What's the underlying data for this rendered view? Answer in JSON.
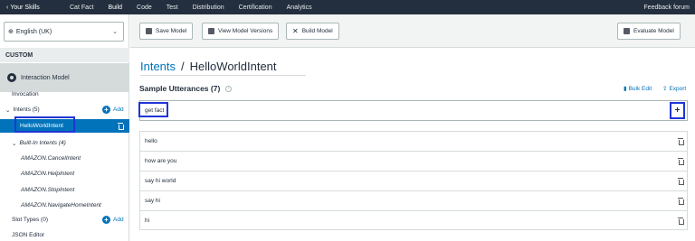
{
  "topnav": {
    "back_label": "Your Skills",
    "tabs": [
      "Cat Fact",
      "Build",
      "Code",
      "Test",
      "Distribution",
      "Certification",
      "Analytics"
    ],
    "active_tab": "Build",
    "feedback": "Feedback forum"
  },
  "sidebar": {
    "language": "English (UK)",
    "section": "CUSTOM",
    "interaction_model": "Interaction Model",
    "invocation": "Invocation",
    "intents": "Intents (5)",
    "add_label": "Add",
    "selected_intent": "HelloWorldIntent",
    "builtin": "Built-In Intents (4)",
    "builtin_items": [
      "AMAZON.CancelIntent",
      "AMAZON.HelpIntent",
      "AMAZON.StopIntent",
      "AMAZON.NavigateHomeIntent"
    ],
    "slot_types": "Slot Types (0)",
    "json_editor": "JSON Editor"
  },
  "toolbar": {
    "save": "Save Model",
    "versions": "View Model Versions",
    "build": "Build Model",
    "evaluate": "Evaluate Model"
  },
  "main": {
    "breadcrumb_link": "Intents",
    "breadcrumb_sep": "/",
    "breadcrumb_current": "HelloWorldIntent",
    "title": "Sample Utterances (7)",
    "bulk_edit": "Bulk Edit",
    "export": "Export",
    "input_value": "get fact",
    "utterances": [
      "hello",
      "how are you",
      "say hi world",
      "say hi",
      "hi"
    ]
  },
  "colors": {
    "nav_bg": "#232f3e",
    "accent": "#0073bb",
    "highlight_outline": "#1f35d6"
  }
}
